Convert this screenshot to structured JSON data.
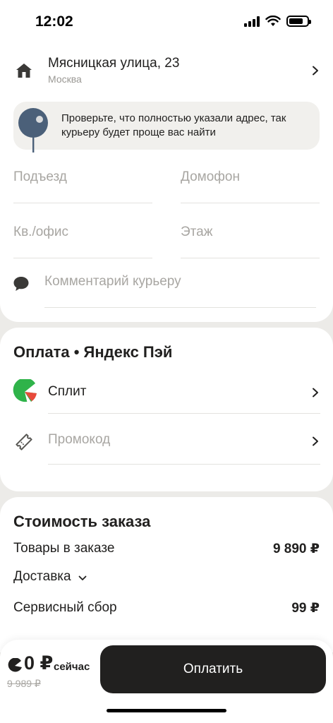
{
  "status_bar": {
    "time": "12:02"
  },
  "address": {
    "street": "Мясницкая улица, 23",
    "city": "Москва",
    "hint": "Проверьте, что полностью указали адрес, так курьеру будет проще вас найти",
    "fields": {
      "entrance": "Подъезд",
      "intercom": "Домофон",
      "apartment": "Кв./офис",
      "floor": "Этаж",
      "comment": "Комментарий курьеру"
    }
  },
  "payment": {
    "title": "Оплата • Яндекс Пэй",
    "split_label": "Сплит",
    "promo_label": "Промокод"
  },
  "cost": {
    "title": "Стоимость заказа",
    "items_label": "Товары в заказе",
    "items_value": "9 890 ₽",
    "delivery_label": "Доставка",
    "service_label": "Сервисный сбор",
    "service_value": "99 ₽"
  },
  "checkout": {
    "price_now": "0 ₽",
    "price_now_label": "сейчас",
    "price_old": "9 989 ₽",
    "pay_label": "Оплатить"
  },
  "colors": {
    "split_green": "#2fb34a",
    "split_red": "#e84a3b",
    "dark": "#21201f",
    "pin_blue": "#4b6079"
  }
}
